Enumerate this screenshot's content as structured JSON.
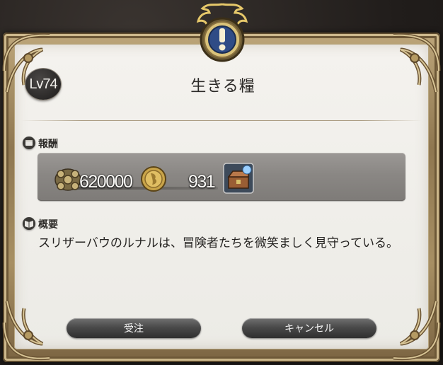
{
  "dialog": {
    "level": "Lv74",
    "title": "生きる糧",
    "crest_icon": "exclamation-crest-icon"
  },
  "rewards": {
    "label": "報酬",
    "gil": "620000",
    "seal": "931",
    "gil_icon": "gil-icon",
    "seal_icon": "seal-coin-icon",
    "item_icon": "hq-treasure-box-icon"
  },
  "summary": {
    "label": "概要",
    "text": "スリザーバウのルナルは、冒険者たちを微笑ましく見守っている。"
  },
  "buttons": {
    "accept": "受注",
    "cancel": "キャンセル"
  },
  "colors": {
    "frame_gold": "#bda67a",
    "panel": "#f0eee9",
    "reward_box": "#8a8784",
    "button_dark": "#3a3a3a"
  }
}
